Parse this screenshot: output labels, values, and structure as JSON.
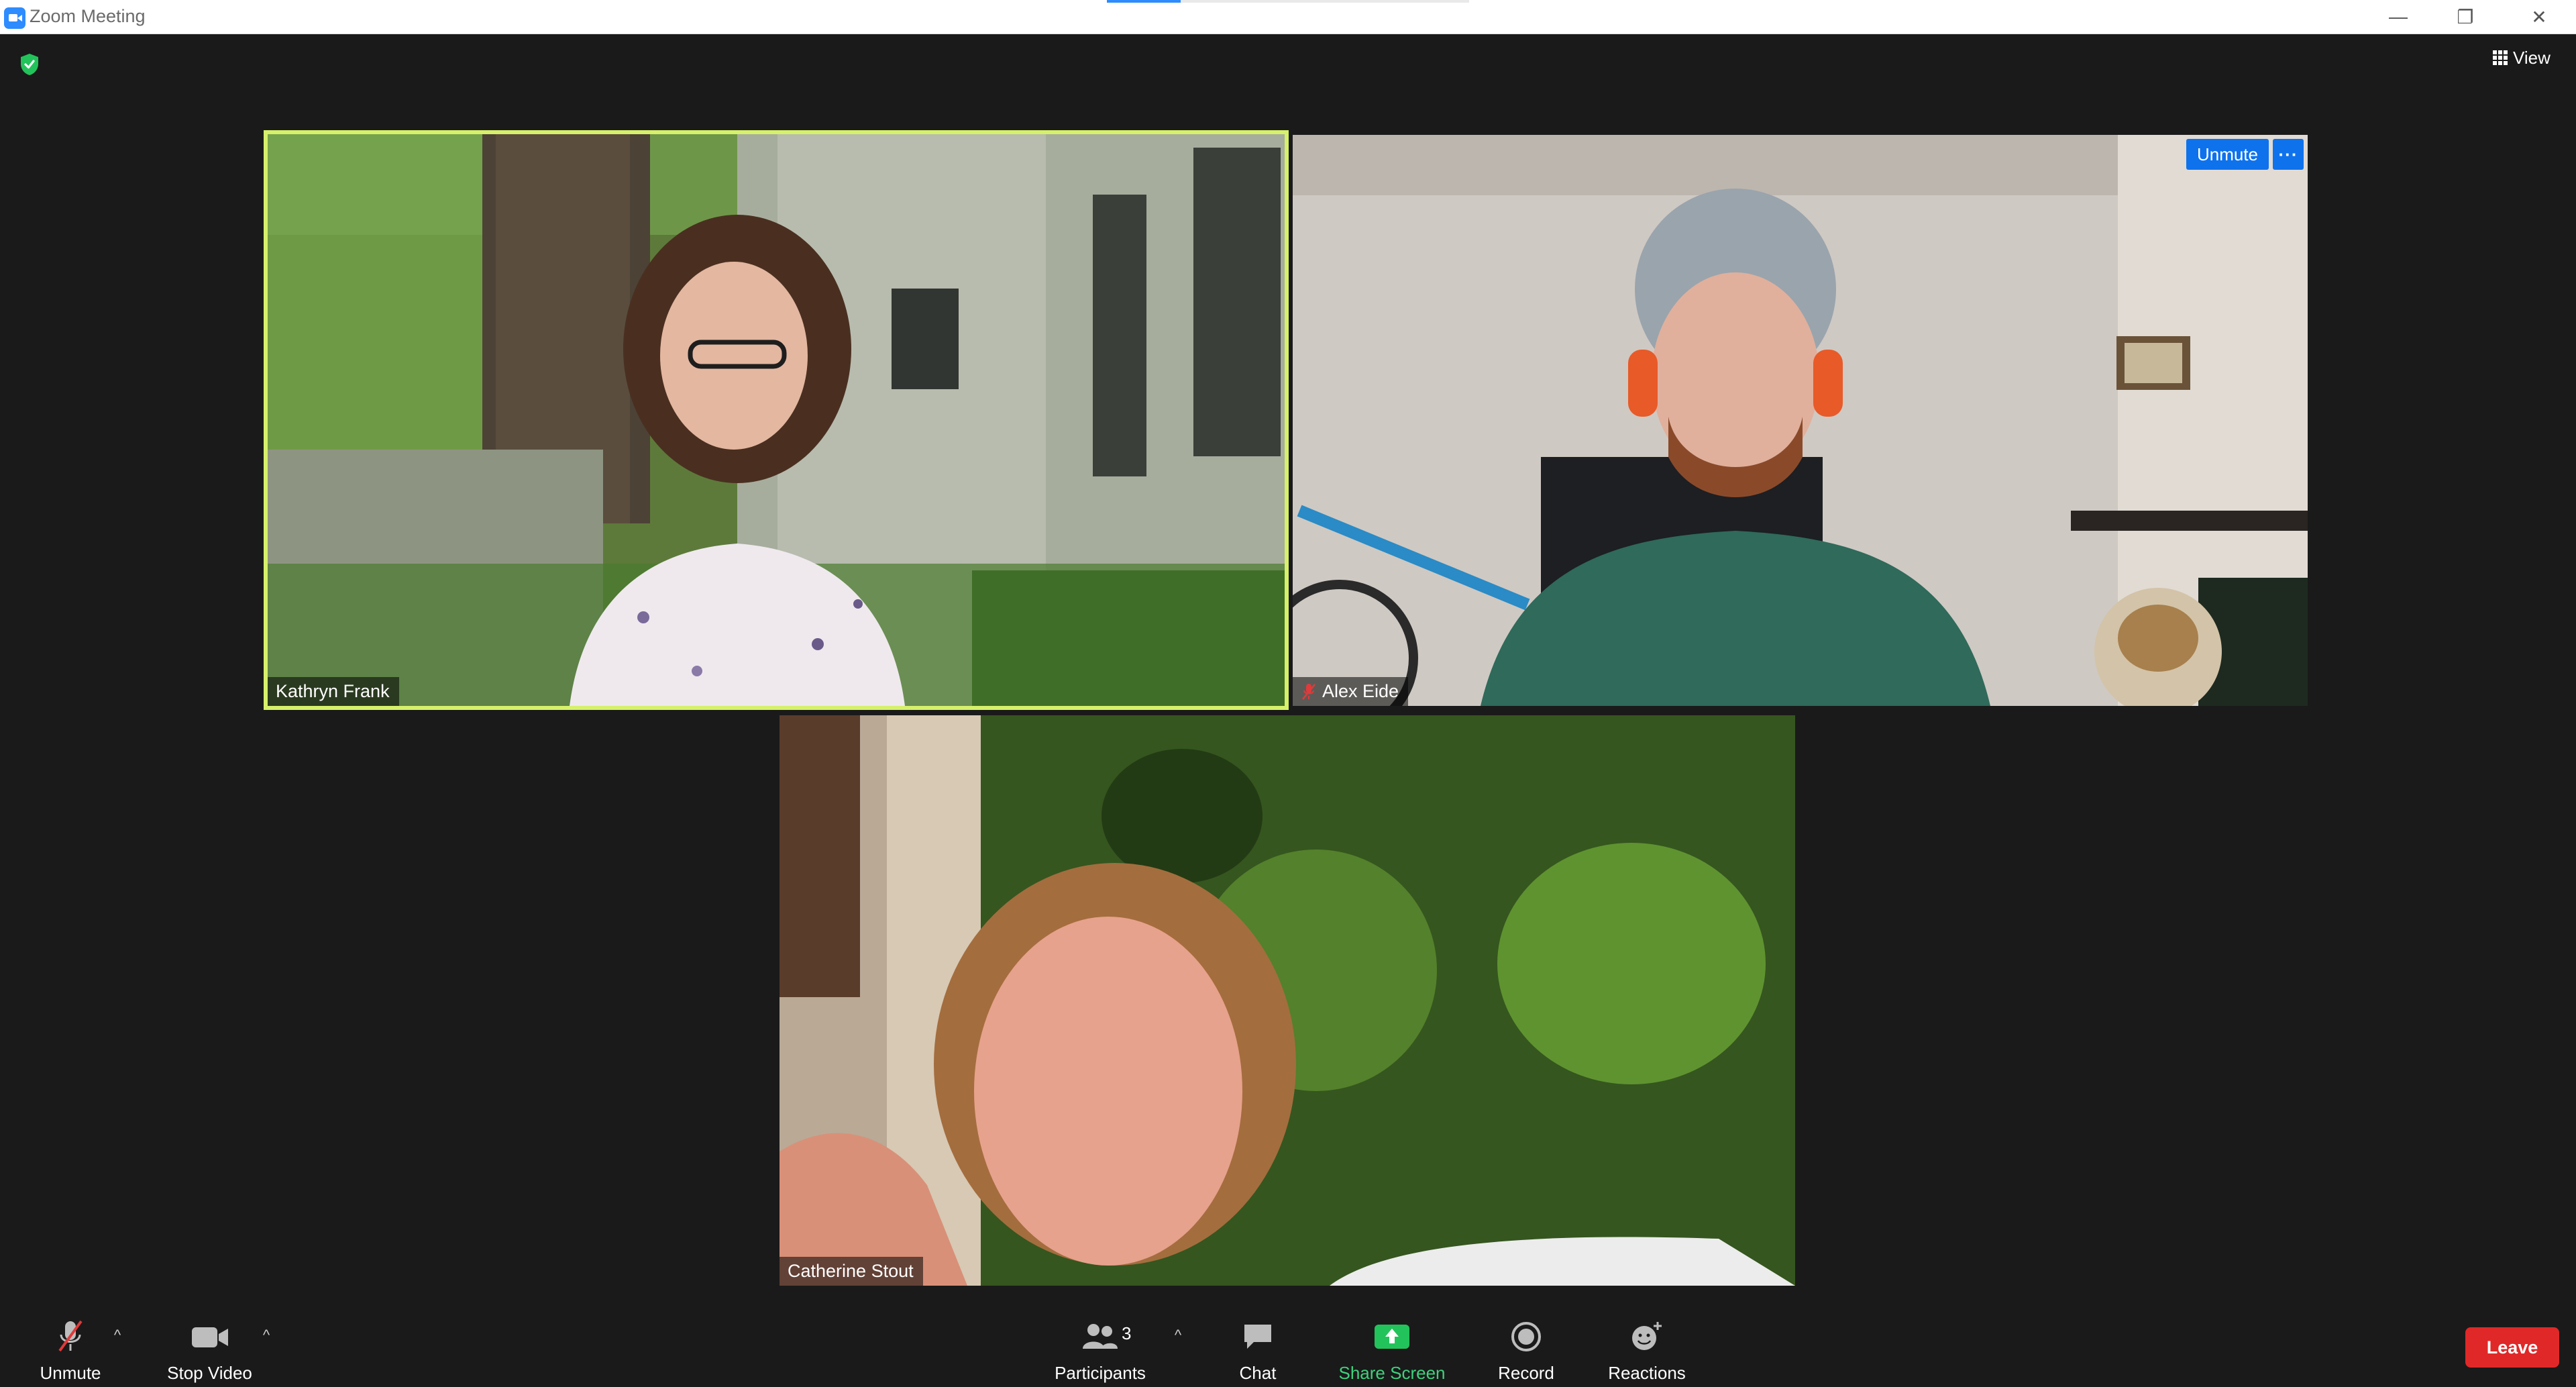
{
  "window": {
    "title": "Zoom Meeting",
    "minimize_glyph": "—",
    "restore_glyph": "❐",
    "close_glyph": "✕"
  },
  "top": {
    "view_label": "View"
  },
  "participants_tiles": [
    {
      "name": "Kathryn Frank",
      "active_speaker": true,
      "muted": false
    },
    {
      "name": "Alex Eide",
      "active_speaker": false,
      "muted": true,
      "unmute_label": "Unmute",
      "more_label": "···"
    },
    {
      "name": "Catherine Stout",
      "active_speaker": false,
      "muted": false
    }
  ],
  "toolbar": {
    "unmute_label": "Unmute",
    "stop_video_label": "Stop Video",
    "participants_label": "Participants",
    "participants_count": "3",
    "chat_label": "Chat",
    "share_label": "Share Screen",
    "record_label": "Record",
    "reactions_label": "Reactions",
    "leave_label": "Leave",
    "caret_glyph": "^"
  },
  "colors": {
    "accent_blue": "#0e72ed",
    "active_speaker_border": "#d6f06b",
    "share_green": "#3fd17d",
    "leave_red": "#e02828",
    "background": "#1a1a1a"
  },
  "icons": [
    "zoom-logo-icon",
    "shield-check-icon",
    "grid-view-icon",
    "muted-mic-icon",
    "camera-icon",
    "participants-icon",
    "chat-icon",
    "share-screen-icon",
    "record-icon",
    "reactions-icon"
  ]
}
